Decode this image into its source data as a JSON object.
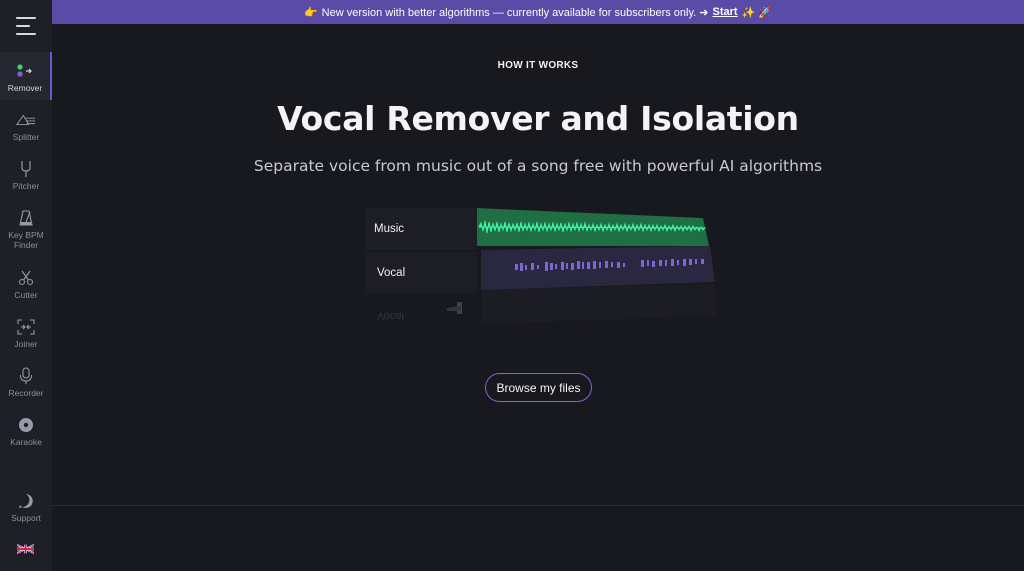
{
  "banner": {
    "emoji_left": "👉",
    "text": "New version with better algorithms — currently available for subscribers only. ➜",
    "start_label": "Start",
    "emoji_right": "✨ 🚀"
  },
  "sidebar": {
    "items": [
      {
        "label": "Remover",
        "icon": "remover-icon",
        "active": true
      },
      {
        "label": "Splitter",
        "icon": "splitter-icon"
      },
      {
        "label": "Pitcher",
        "icon": "tuning-fork-icon"
      },
      {
        "label": "Key BPM Finder",
        "icon": "metronome-icon"
      },
      {
        "label": "Cutter",
        "icon": "scissors-icon"
      },
      {
        "label": "Joiner",
        "icon": "joiner-icon"
      },
      {
        "label": "Recorder",
        "icon": "microphone-icon"
      },
      {
        "label": "Karaoke",
        "icon": "disc-icon"
      }
    ],
    "support_label": "Support",
    "language": "uk-flag-icon"
  },
  "main": {
    "kicker": "HOW IT WORKS",
    "title": "Vocal Remover and Isolation",
    "subtitle": "Separate voice from music out of a song free with powerful AI algorithms",
    "demo": {
      "tracks": [
        {
          "label": "Music",
          "color": "#22c96a"
        },
        {
          "label": "Vocal",
          "color": "#6a5acd"
        }
      ],
      "reflection_label": "Vocal"
    },
    "browse_label": "Browse my files"
  },
  "colors": {
    "accent": "#5a4ba6",
    "background": "#18181f",
    "sidebar": "#1f1f28"
  }
}
